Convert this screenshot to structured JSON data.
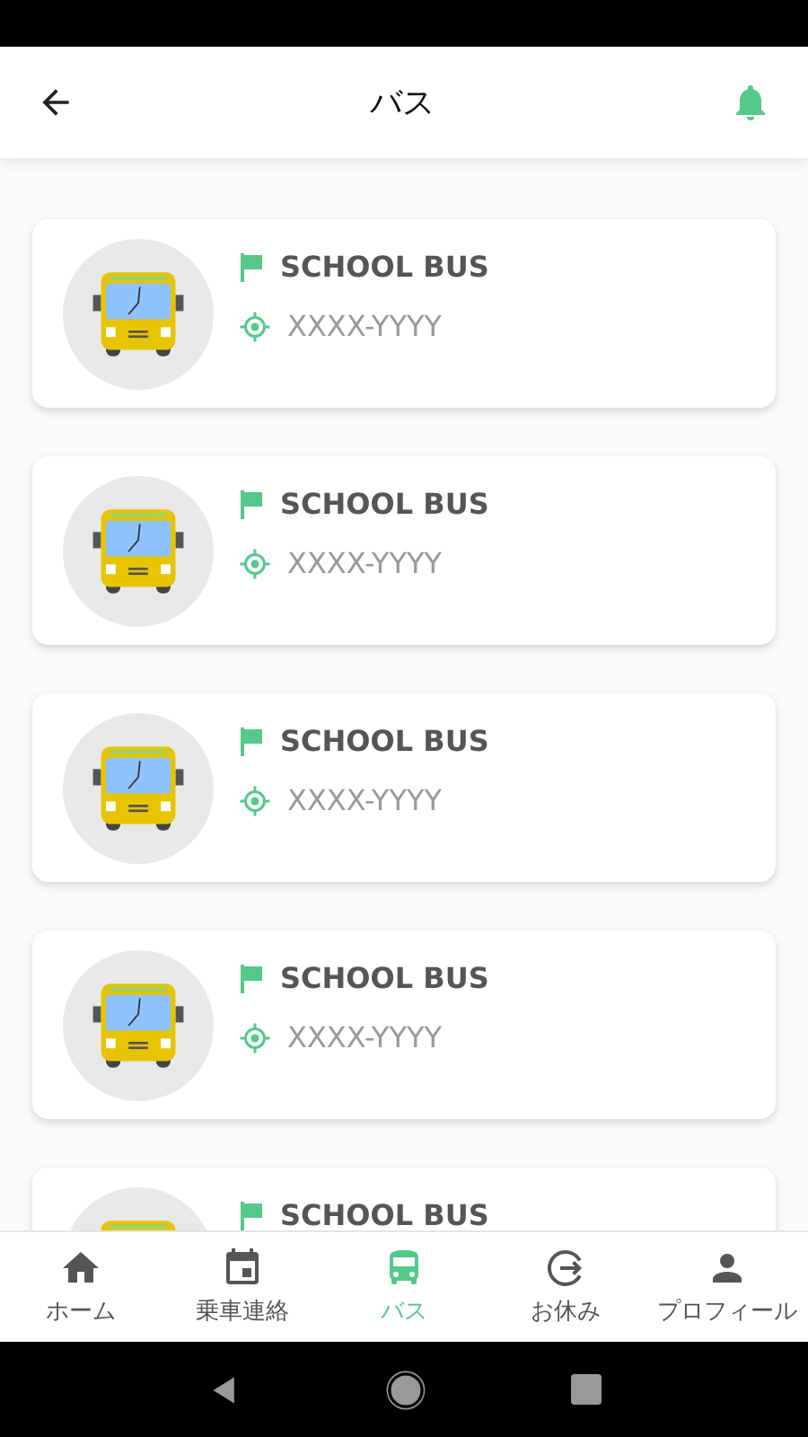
{
  "header": {
    "title": "バス"
  },
  "buses": [
    {
      "name": "SCHOOL BUS",
      "code": "XXXX-YYYY"
    },
    {
      "name": "SCHOOL BUS",
      "code": "XXXX-YYYY"
    },
    {
      "name": "SCHOOL BUS",
      "code": "XXXX-YYYY"
    },
    {
      "name": "SCHOOL BUS",
      "code": "XXXX-YYYY"
    },
    {
      "name": "SCHOOL BUS"
    }
  ],
  "bottom_nav": [
    {
      "label": "ホーム",
      "selected": false
    },
    {
      "label": "乗車連絡",
      "selected": false
    },
    {
      "label": "バス",
      "selected": true
    },
    {
      "label": "お休み",
      "selected": false
    },
    {
      "label": "プロフィール",
      "selected": false
    }
  ]
}
